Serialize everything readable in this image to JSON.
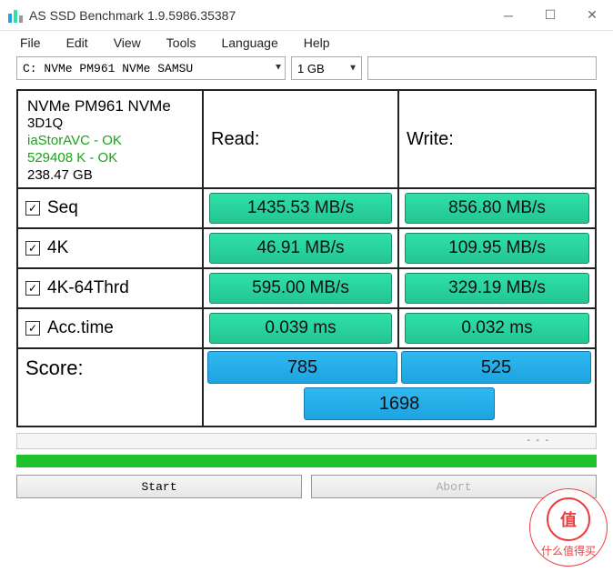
{
  "window": {
    "title": "AS SSD Benchmark 1.9.5986.35387"
  },
  "menu": {
    "file": "File",
    "edit": "Edit",
    "view": "View",
    "tools": "Tools",
    "language": "Language",
    "help": "Help"
  },
  "toolbar": {
    "drive": "C: NVMe PM961 NVMe SAMSU",
    "size": "1 GB"
  },
  "drive_info": {
    "name": "NVMe PM961 NVMe",
    "firmware": "3D1Q",
    "driver": "iaStorAVC - OK",
    "alignment": "529408 K - OK",
    "capacity": "238.47 GB"
  },
  "headers": {
    "read": "Read:",
    "write": "Write:"
  },
  "tests": {
    "seq": {
      "label": "Seq",
      "checked": true,
      "read": "1435.53 MB/s",
      "write": "856.80 MB/s"
    },
    "4k": {
      "label": "4K",
      "checked": true,
      "read": "46.91 MB/s",
      "write": "109.95 MB/s"
    },
    "4k64": {
      "label": "4K-64Thrd",
      "checked": true,
      "read": "595.00 MB/s",
      "write": "329.19 MB/s"
    },
    "acc": {
      "label": "Acc.time",
      "checked": true,
      "read": "0.039 ms",
      "write": "0.032 ms"
    }
  },
  "score": {
    "label": "Score:",
    "read": "785",
    "write": "525",
    "total": "1698"
  },
  "buttons": {
    "start": "Start",
    "abort": "Abort"
  },
  "watermark": {
    "char": "值",
    "text": "什么值得买"
  }
}
